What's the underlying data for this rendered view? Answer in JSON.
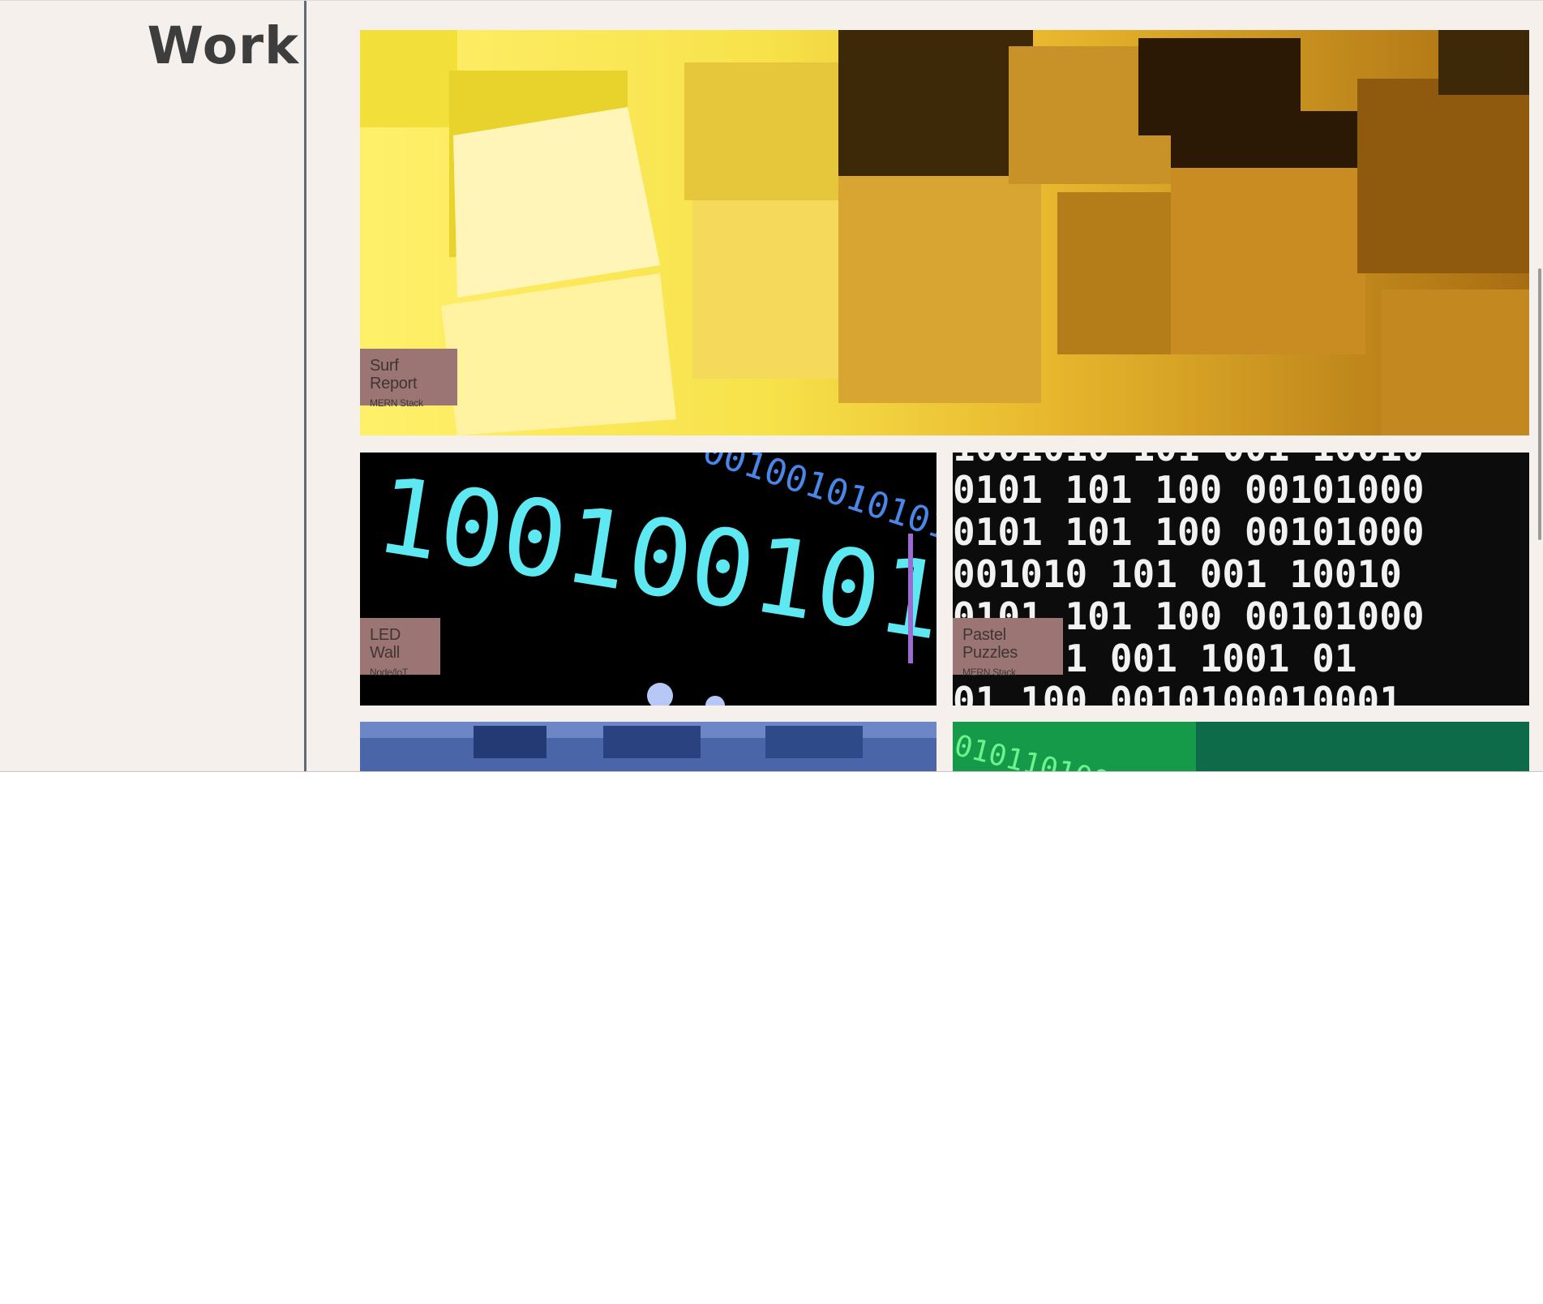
{
  "section": {
    "title": "Work"
  },
  "projects": [
    {
      "title": "Surf Report",
      "stack": "MERN Stack"
    },
    {
      "title": "LED Wall",
      "stack": "Node/IoT"
    },
    {
      "title": "Pastel Puzzles",
      "stack": "MERN Stack"
    },
    {
      "title": "",
      "stack": ""
    },
    {
      "title": "",
      "stack": ""
    }
  ],
  "colors": {
    "background": "#f6f0ec",
    "divider": "#5d6a77",
    "caption_bg": "#9b7574",
    "caption_text": "#3f3534"
  }
}
